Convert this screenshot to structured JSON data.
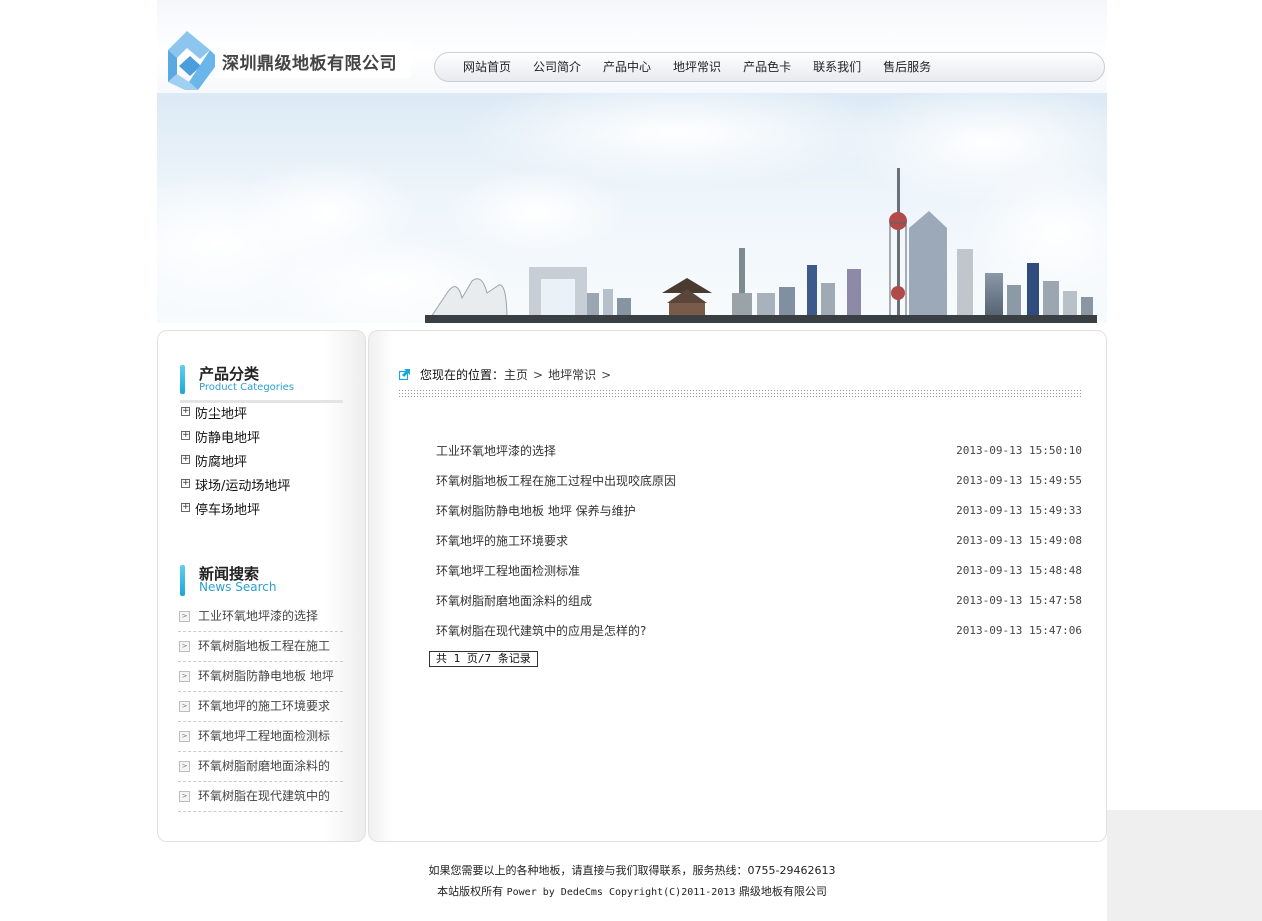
{
  "site": {
    "company_name": "深圳鼎级地板有限公司"
  },
  "nav": {
    "items": [
      "网站首页",
      "公司简介",
      "产品中心",
      "地坪常识",
      "产品色卡",
      "联系我们",
      "售后服务"
    ]
  },
  "sidebar": {
    "categories_title": "产品分类",
    "categories_subtitle": "Product Categories",
    "categories": [
      "防尘地坪",
      "防静电地坪",
      "防腐地坪",
      "球场/运动场地坪",
      "停车场地坪"
    ],
    "news_title": "新闻搜索",
    "news_subtitle": "News Search",
    "news": [
      "工业环氧地坪漆的选择",
      "环氧树脂地板工程在施工",
      "环氧树脂防静电地板 地坪",
      "环氧地坪的施工环境要求",
      "环氧地坪工程地面检测标",
      "环氧树脂耐磨地面涂料的",
      "环氧树脂在现代建筑中的"
    ]
  },
  "breadcrumb": {
    "label": "您现在的位置：",
    "home": "主页",
    "current": "地坪常识",
    "separator": ">"
  },
  "articles": [
    {
      "title": "工业环氧地坪漆的选择",
      "date": "2013-09-13 15:50:10"
    },
    {
      "title": "环氧树脂地板工程在施工过程中出现咬底原因",
      "date": "2013-09-13 15:49:55"
    },
    {
      "title": "环氧树脂防静电地板 地坪 保养与维护",
      "date": "2013-09-13 15:49:33"
    },
    {
      "title": "环氧地坪的施工环境要求",
      "date": "2013-09-13 15:49:08"
    },
    {
      "title": "环氧地坪工程地面检测标准",
      "date": "2013-09-13 15:48:48"
    },
    {
      "title": "环氧树脂耐磨地面涂料的组成",
      "date": "2013-09-13 15:47:58"
    },
    {
      "title": "环氧树脂在现代建筑中的应用是怎样的?",
      "date": "2013-09-13 15:47:06"
    }
  ],
  "pager": {
    "text": "共 1 页/7 条记录"
  },
  "footer": {
    "line1": "如果您需要以上的各种地板，请直接与我们取得联系，服务热线：0755-29462613",
    "line2_prefix": "本站版权所有",
    "line2_power": "Power by DedeCms Copyright(C)2011-2013",
    "line2_company": "鼎级地板有限公司"
  },
  "colors": {
    "accent": "#2a9fd0",
    "logo_blue": "#6ab6ea"
  }
}
